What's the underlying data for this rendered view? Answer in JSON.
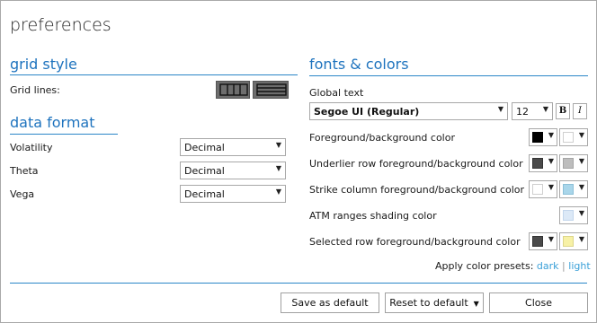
{
  "window": {
    "title": "preferences"
  },
  "grid_style": {
    "title": "grid style",
    "grid_lines_label": "Grid lines:"
  },
  "data_format": {
    "title": "data format",
    "rows": [
      {
        "label": "Volatility",
        "value": "Decimal"
      },
      {
        "label": "Theta",
        "value": "Decimal"
      },
      {
        "label": "Vega",
        "value": "Decimal"
      }
    ]
  },
  "fonts_colors": {
    "title": "fonts & colors",
    "global_text_label": "Global text",
    "font_family": "Segoe UI (Regular)",
    "font_size": "12",
    "bold_label": "B",
    "italic_label": "I",
    "rows": [
      {
        "label": "Foreground/background color",
        "fg": "#000000",
        "bg": "#ffffff"
      },
      {
        "label": "Underlier row foreground/background color",
        "fg": "#4a4a4a",
        "bg": "#bdbdbd"
      },
      {
        "label": "Strike column foreground/background color",
        "fg": "#ffffff",
        "bg": "#a9d6ea"
      },
      {
        "label": "ATM ranges shading color",
        "fg": "",
        "bg": "#dce9f7"
      },
      {
        "label": "Selected row foreground/background color",
        "fg": "#4a4a4a",
        "bg": "#f7f1a6"
      }
    ],
    "presets": {
      "label": "Apply color presets:",
      "dark": "dark",
      "light": "light"
    }
  },
  "buttons": {
    "save_default": "Save as default",
    "reset_default": "Reset to default",
    "close": "Close"
  },
  "icons": {
    "dropdown": "▼"
  }
}
